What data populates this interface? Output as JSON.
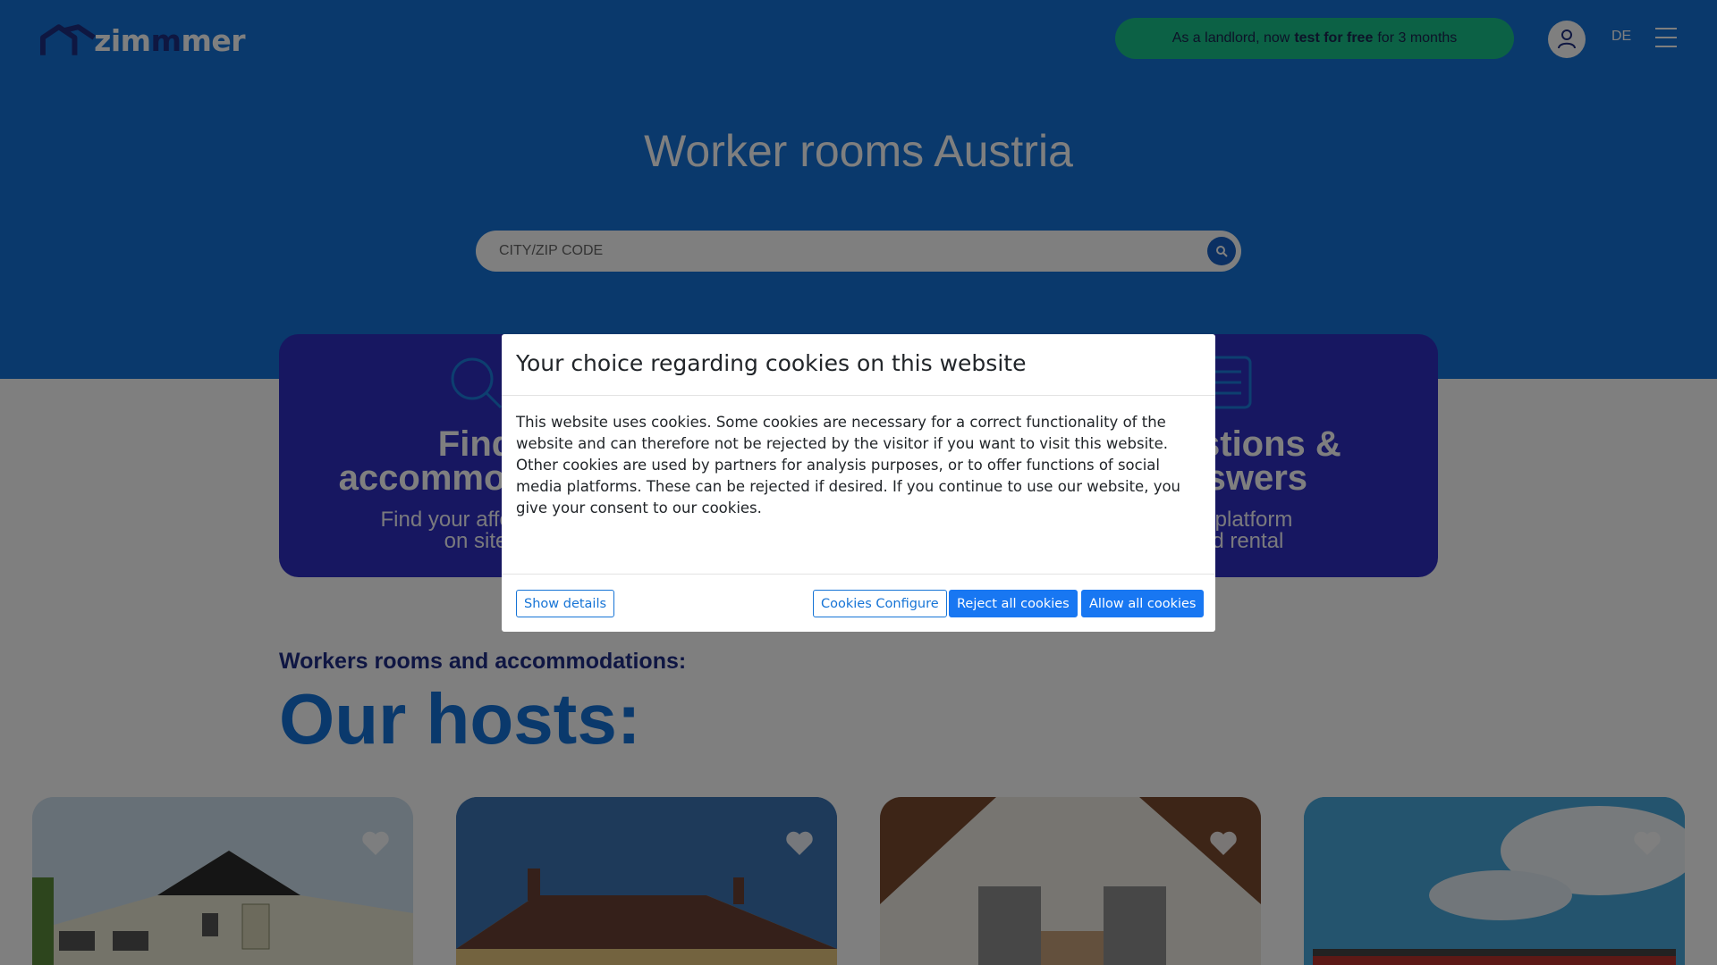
{
  "header": {
    "logo_text_start": "zim",
    "logo_text_mid": "m",
    "logo_text_end": "er",
    "promo_before": "As a landlord, now",
    "promo_bold": "test for free",
    "promo_after": "for 3 months",
    "language": "DE",
    "icons": [
      "house-roof-icon",
      "user-icon",
      "hamburger-menu-icon"
    ]
  },
  "hero": {
    "title": "Worker rooms Austria",
    "search_placeholder": "CITY/ZIP CODE",
    "search_icon": "search-icon"
  },
  "features": [
    {
      "icon": "search-icon",
      "title_line1": "Find",
      "title_line2": "accommodation",
      "desc_line1": "Find your affordable",
      "desc_line2": "on site"
    },
    {
      "icon": "list-document-icon",
      "title_line1": "Questions &",
      "title_line2": "answers",
      "desc_line1": "the platform",
      "desc_line2": "and rental"
    }
  ],
  "section": {
    "subtitle": "Workers rooms and accommodations:",
    "title": "Our hosts:"
  },
  "cards": [
    {
      "icon": "heart-icon"
    },
    {
      "icon": "heart-icon"
    },
    {
      "icon": "heart-icon"
    },
    {
      "icon": "heart-icon"
    }
  ],
  "cookie_modal": {
    "title": "Your choice regarding cookies on this website",
    "body": "This website uses cookies. Some cookies are necessary for a correct functionality of the website and can therefore not be rejected by the visitor if you want to visit this website. Other cookies are used by partners for analysis purposes, or to offer functions of social media platforms. These can be rejected if desired. If you continue to use our website, you give your consent to our cookies.",
    "show_details": "Show details",
    "configure": "Cookies Configure",
    "reject_all": "Reject all cookies",
    "allow_all": "Allow all cookies"
  },
  "colors": {
    "hero_blue": "#1472d8",
    "feature_indigo": "#2f2ec3",
    "promo_green": "#19c38a",
    "button_blue": "#1877f2"
  }
}
